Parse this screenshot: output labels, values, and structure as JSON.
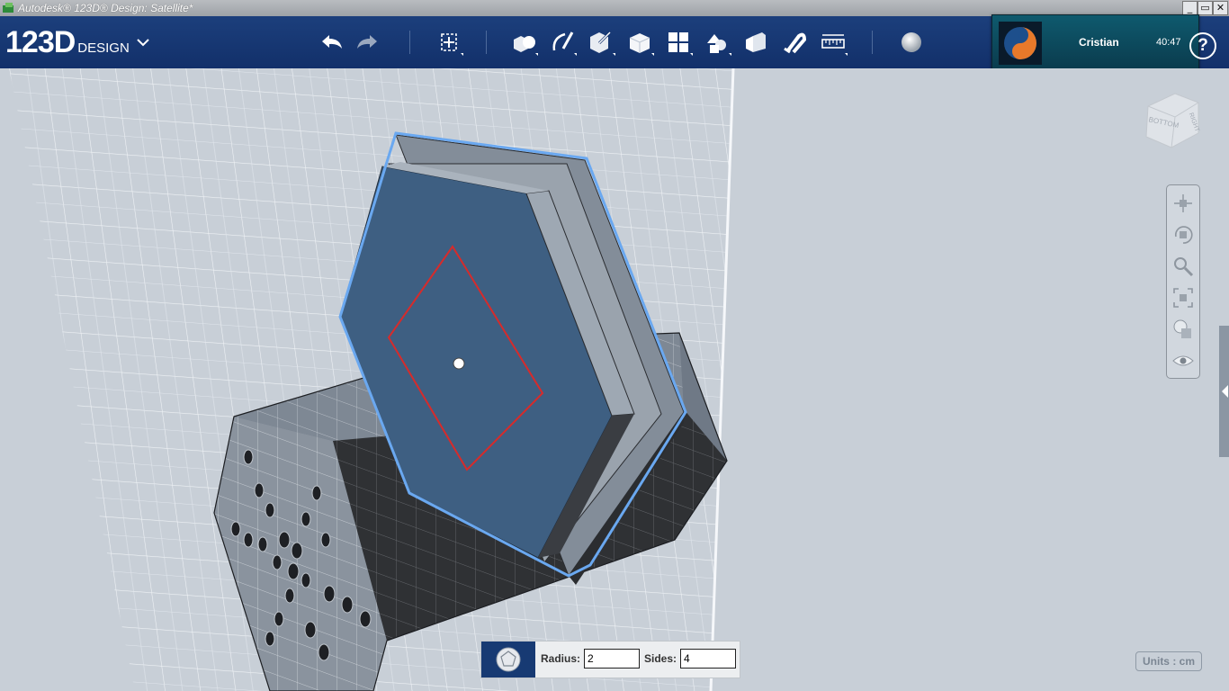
{
  "window": {
    "title": "Autodesk® 123D® Design: Satellite*",
    "controls": [
      "_",
      "▭",
      "✕"
    ]
  },
  "logo": {
    "main": "123D",
    "sub": "DESIGN"
  },
  "toolbar": {
    "buttons": [
      {
        "name": "undo",
        "icon": "undo-arrow-icon"
      },
      {
        "name": "redo",
        "icon": "redo-arrow-icon"
      },
      {
        "name": "transform",
        "icon": "transform-icon"
      },
      {
        "name": "primitives",
        "icon": "primitives-icon"
      },
      {
        "name": "sketch",
        "icon": "sketch-icon"
      },
      {
        "name": "construct",
        "icon": "construct-icon"
      },
      {
        "name": "modify",
        "icon": "modify-icon"
      },
      {
        "name": "pattern",
        "icon": "pattern-icon"
      },
      {
        "name": "grouping",
        "icon": "grouping-icon"
      },
      {
        "name": "combine",
        "icon": "combine-icon"
      },
      {
        "name": "snap",
        "icon": "magnet-icon"
      },
      {
        "name": "measure",
        "icon": "ruler-icon"
      },
      {
        "name": "material",
        "icon": "material-sphere-icon"
      }
    ]
  },
  "user": {
    "name": "Cristian",
    "time": "40:47"
  },
  "help_label": "?",
  "viewcube": {
    "face_left": "BOTTOM",
    "face_right": "RIGHT"
  },
  "navbar": {
    "buttons": [
      "pan-icon",
      "orbit-icon",
      "zoom-icon",
      "fit-icon",
      "view-style-icon",
      "visibility-icon"
    ]
  },
  "polygon_panel": {
    "radius_label": "Radius:",
    "radius_value": "2",
    "sides_label": "Sides:",
    "sides_value": "4"
  },
  "units_label": "Units : cm",
  "colors": {
    "toolbar_bg": "#1a3c78",
    "selection_outline": "#6aa8f0",
    "sketch_outline": "#d62b2b",
    "face_blue": "#3e5f82",
    "body_gray": "#7b8591"
  }
}
